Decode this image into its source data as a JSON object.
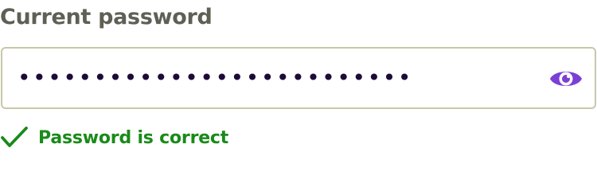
{
  "field": {
    "label": "Current password",
    "value": "••••••••••••••••••••••••••",
    "input_type": "password",
    "toggle_icon": "eye-icon"
  },
  "validation": {
    "icon": "check-icon",
    "message": "Password is correct",
    "color": "#1a8a1a"
  },
  "colors": {
    "label": "#5f5f55",
    "input_border": "#c8c7a9",
    "mask_dots": "#1e0a38",
    "eye_icon": "#7c3fd6",
    "success": "#1a8a1a"
  }
}
